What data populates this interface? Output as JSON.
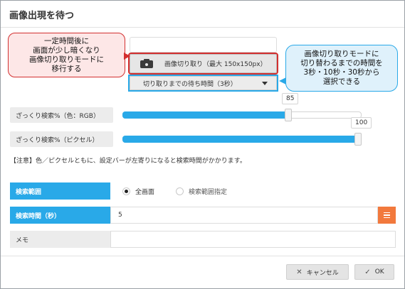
{
  "dialog": {
    "title": "画像出現を待つ"
  },
  "crop": {
    "button_label": "画像切り取り（最大 150x150px）",
    "icon": "camera-icon",
    "wait_select_label": "切り取りまでの待ち時間（3秒）"
  },
  "callouts": {
    "left": [
      "一定時間後に",
      "画面が少し暗くなり",
      "画像切り取りモードに",
      "移行する"
    ],
    "right": [
      "画像切り取りモードに",
      "切り替わるまでの時間を",
      "3秒・10秒・30秒から",
      "選択できる"
    ]
  },
  "sliders": {
    "rgb": {
      "label": "ざっくり検索%（色：RGB）",
      "value": "85",
      "fraction": 0.7
    },
    "pixel": {
      "label": "ざっくり検索%（ピクセル）",
      "value": "100",
      "fraction": 1.0
    }
  },
  "note": "【注意】色／ピクセルともに、設定バーが左寄りになると検索時間がかかります。",
  "search_range": {
    "label": "検索範囲",
    "options": [
      "全画面",
      "検索範囲指定"
    ],
    "selected": "全画面"
  },
  "search_time": {
    "label": "検索時間（秒）",
    "value": "5",
    "menu_icon": "menu-icon"
  },
  "memo": {
    "label": "メモ",
    "value": ""
  },
  "footer": {
    "cancel_label": "キャンセル",
    "ok_label": "OK"
  },
  "colors": {
    "accent_blue": "#29a9e8",
    "alert_red": "#d32f2f",
    "orange": "#f2793d"
  }
}
